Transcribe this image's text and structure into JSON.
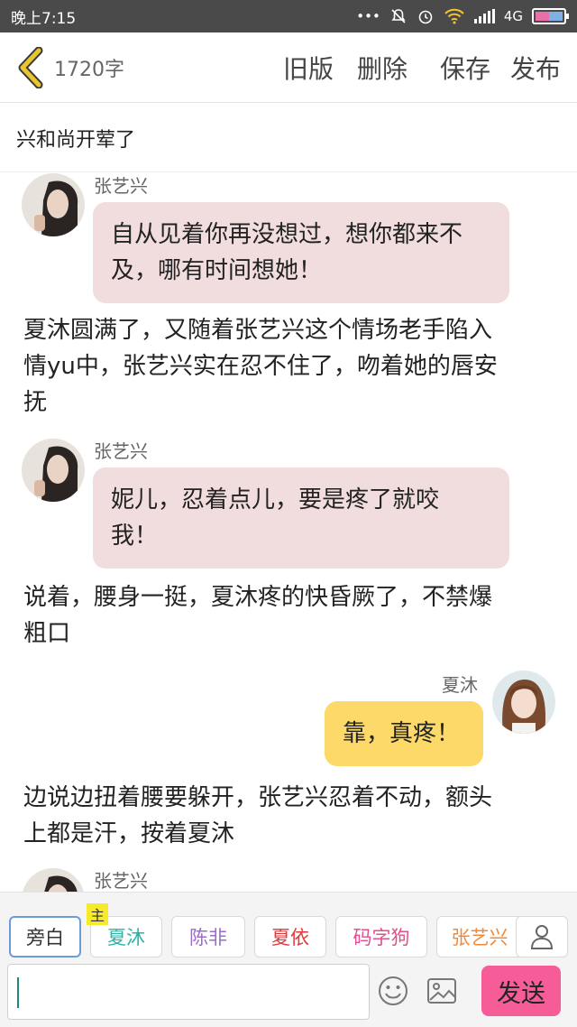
{
  "status_bar": {
    "time": "晚上7:15",
    "network": "4G"
  },
  "header": {
    "word_count": "1720字",
    "buttons": {
      "old_version": "旧版",
      "delete": "删除",
      "save": "保存",
      "publish": "发布"
    }
  },
  "story": {
    "title": "兴和尚开荤了"
  },
  "messages": [
    {
      "type": "left",
      "name": "张艺兴",
      "lines": [
        "自从见着你再没想过，想你都来不",
        "及，哪有时间想她！"
      ]
    },
    {
      "type": "narration",
      "lines": [
        "夏沐圆满了，又随着张艺兴这个情场老手陷入",
        "情yu中，张艺兴实在忍不住了，吻着她的唇安",
        "抚"
      ]
    },
    {
      "type": "left",
      "name": "张艺兴",
      "lines": [
        "妮儿，忍着点儿，要是疼了就咬",
        "我！"
      ]
    },
    {
      "type": "narration",
      "lines": [
        "说着，腰身一挺，夏沐疼的快昏厥了，不禁爆",
        "粗口"
      ]
    },
    {
      "type": "right",
      "name": "夏沐",
      "lines": [
        "靠，真疼！"
      ]
    },
    {
      "type": "narration",
      "lines": [
        "边说边扭着腰要躲开，张艺兴忍着不动，额头",
        "上都是汗，按着夏沐"
      ]
    },
    {
      "type": "left",
      "name": "张艺兴",
      "lines": []
    }
  ],
  "characters": {
    "host_badge": "主",
    "items": [
      {
        "label": "旁白",
        "color": "#333333"
      },
      {
        "label": "夏沐",
        "color": "#2bb3a6"
      },
      {
        "label": "陈非",
        "color": "#9a6dcc"
      },
      {
        "label": "夏依",
        "color": "#e0393a"
      },
      {
        "label": "码字狗",
        "color": "#e34f8c"
      },
      {
        "label": "张艺兴",
        "color": "#f08a3b"
      }
    ]
  },
  "composer": {
    "send_label": "发送"
  },
  "icons": [
    "back-chevron-icon",
    "silent-icon",
    "alarm-icon",
    "wifi-icon",
    "signal-icon",
    "battery-icon",
    "user-icon",
    "emoji-icon",
    "image-icon"
  ],
  "colors": {
    "pink_bubble": "#f1dddd",
    "yellow_bubble": "#fcd969",
    "send_button": "#f65d98",
    "back_chevron": "#e9c530"
  }
}
